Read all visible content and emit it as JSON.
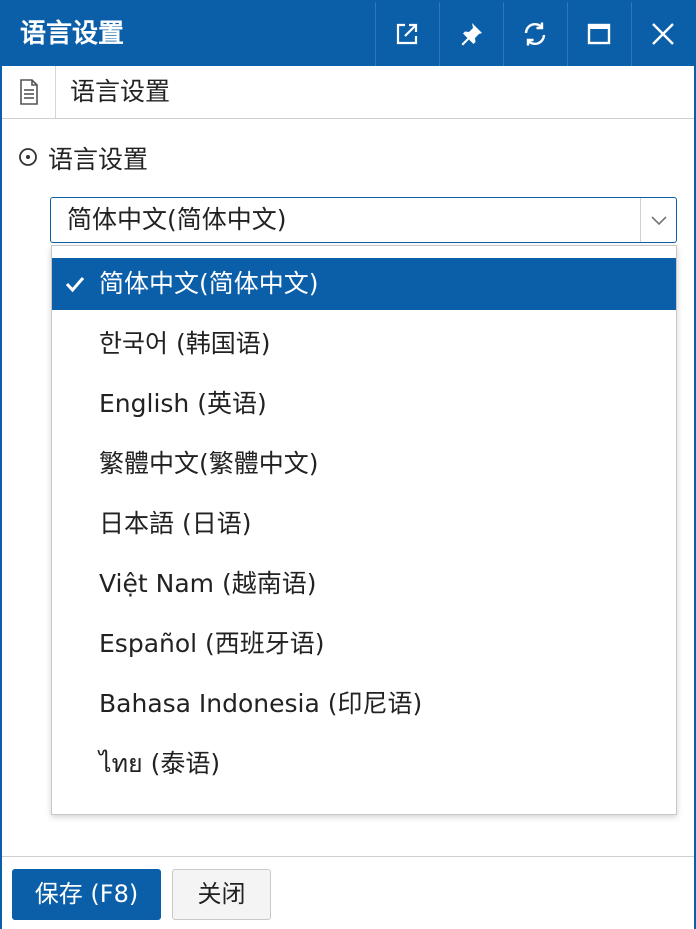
{
  "window": {
    "title": "语言设置",
    "buttons": [
      "popout-icon",
      "pin-icon",
      "refresh-icon",
      "maximize-icon",
      "close-icon"
    ]
  },
  "tab": {
    "icon": "document-icon",
    "label": "语言设置"
  },
  "section": {
    "icon": "circle-dot-icon",
    "title": "语言设置"
  },
  "language_select": {
    "value": "简体中文(简体中文)",
    "arrow_icon": "chevron-down-icon",
    "options": [
      {
        "label": "简体中文(简体中文)",
        "selected": true
      },
      {
        "label": "한국어 (韩国语)",
        "selected": false
      },
      {
        "label": "English (英语)",
        "selected": false
      },
      {
        "label": "繁體中文(繁體中文)",
        "selected": false
      },
      {
        "label": "日本語 (日语)",
        "selected": false
      },
      {
        "label": "Việt Nam (越南语)",
        "selected": false
      },
      {
        "label": "Español (西班牙语)",
        "selected": false
      },
      {
        "label": "Bahasa Indonesia (印尼语)",
        "selected": false
      },
      {
        "label": "ไทย (泰语)",
        "selected": false
      }
    ]
  },
  "footer": {
    "save_label": "保存 (F8)",
    "close_label": "关闭"
  },
  "colors": {
    "accent": "#0b5ea8",
    "selected_bg": "#0b5ea8",
    "text": "#222222"
  }
}
